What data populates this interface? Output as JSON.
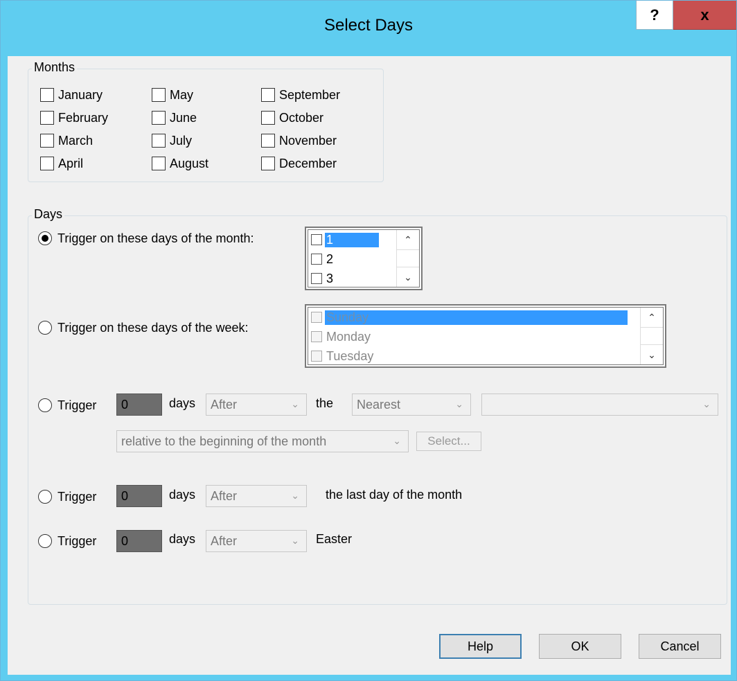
{
  "window": {
    "title": "Select Days",
    "help_glyph": "?",
    "close_glyph": "x"
  },
  "months": {
    "legend": "Months",
    "items": [
      "January",
      "February",
      "March",
      "April",
      "May",
      "June",
      "July",
      "August",
      "September",
      "October",
      "November",
      "December"
    ]
  },
  "days": {
    "legend": "Days",
    "opt_month_label": "Trigger on these days of the month:",
    "opt_week_label": "Trigger on these days of the week:",
    "month_days": [
      "1",
      "2",
      "3"
    ],
    "week_days": [
      "Sunday",
      "Monday",
      "Tuesday"
    ],
    "trigger_label": "Trigger",
    "days_label": "days",
    "after": "After",
    "the_label": "the",
    "nearest": "Nearest",
    "empty_combo": "",
    "relative": "relative to the beginning of the month",
    "select_btn": "Select...",
    "num_value": "0",
    "last_day_label": "the last day of the month",
    "easter_label": "Easter"
  },
  "buttons": {
    "help": "Help",
    "ok": "OK",
    "cancel": "Cancel"
  },
  "icons": {
    "scroll_up": "chevron-up-icon",
    "scroll_down": "chevron-down-icon"
  }
}
